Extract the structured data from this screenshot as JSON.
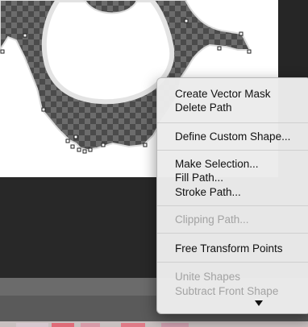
{
  "context_menu": {
    "items": [
      {
        "label": "Create Vector Mask",
        "enabled": true
      },
      {
        "label": "Delete Path",
        "enabled": true
      },
      {
        "label": "Define Custom Shape...",
        "enabled": true
      },
      {
        "label": "Make Selection...",
        "enabled": true
      },
      {
        "label": "Fill Path...",
        "enabled": true
      },
      {
        "label": "Stroke Path...",
        "enabled": true
      },
      {
        "label": "Clipping Path...",
        "enabled": false
      },
      {
        "label": "Free Transform Points",
        "enabled": true
      },
      {
        "label": "Unite Shapes",
        "enabled": false
      },
      {
        "label": "Subtract Front Shape",
        "enabled": false
      }
    ],
    "scroll_indicator": "chevron-down-icon"
  },
  "colors": {
    "menu_background": "#ececec",
    "canvas_background": "#ffffff",
    "workspace": "#2a2a2a",
    "shape_fill_dark": "#4a4a4a",
    "shape_fill_light": "#6e6e6e"
  }
}
